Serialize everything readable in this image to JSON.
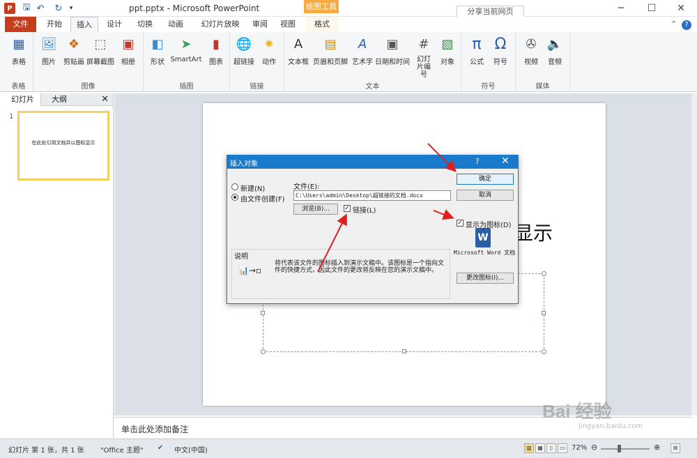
{
  "window": {
    "app_icon": "P",
    "title": "ppt.pptx - Microsoft PowerPoint",
    "context_tab_group": "绘图工具",
    "share_button": "分享当前网页"
  },
  "tabs": {
    "file": "文件",
    "items": [
      "开始",
      "插入",
      "设计",
      "切换",
      "动画",
      "幻灯片放映",
      "审阅",
      "视图",
      "格式"
    ],
    "active": "插入"
  },
  "ribbon": {
    "groups": [
      {
        "label": "表格",
        "buttons": [
          "表格"
        ]
      },
      {
        "label": "图像",
        "buttons": [
          "图片",
          "剪贴画",
          "屏幕截图",
          "相册"
        ]
      },
      {
        "label": "插图",
        "buttons": [
          "形状",
          "SmartArt",
          "图表"
        ]
      },
      {
        "label": "链接",
        "buttons": [
          "超链接",
          "动作"
        ]
      },
      {
        "label": "文本",
        "buttons": [
          "文本框",
          "页眉和页脚",
          "艺术字",
          "日期和时间",
          "幻灯片编号",
          "对象"
        ]
      },
      {
        "label": "符号",
        "buttons": [
          "公式",
          "符号"
        ]
      },
      {
        "label": "媒体",
        "buttons": [
          "视频",
          "音频"
        ]
      }
    ]
  },
  "left_panel": {
    "tabs": [
      "幻灯片",
      "大纲"
    ],
    "slide_number": "1",
    "thumbnail_text": "在此处引用文档并以图标显示"
  },
  "slide": {
    "visible_text": "显示"
  },
  "notes": {
    "placeholder": "单击此处添加备注"
  },
  "status": {
    "slide_info": "幻灯片 第 1 张，共 1 张",
    "theme": "\"Office 主题\"",
    "language": "中文(中国)",
    "zoom": "72%"
  },
  "dialog": {
    "title": "插入对象",
    "help": "?",
    "close": "✕",
    "radio_new": "新建(N)",
    "radio_from_file": "由文件创建(F)",
    "file_label": "文件(E):",
    "file_path": "C:\\Users\\admin\\Desktop\\超链接的文档.docx",
    "browse_button": "浏览(B)...",
    "link_checkbox": "链接(L)",
    "display_as_icon": "显示为图标(D)",
    "ok_button": "确定",
    "cancel_button": "取消",
    "icon_caption": "Microsoft Word 文档",
    "change_icon_button": "更改图标(I)...",
    "result_label": "说明",
    "result_text": "将代表该文件的图标插入到演示文稿中。该图标是一个指向文件的快捷方式，因此文件的更改将反映在您的演示文稿中。"
  },
  "watermark": {
    "main": "Bai 经验",
    "sub": "jingyan.baidu.com"
  },
  "colors": {
    "accent": "#c43e1c",
    "dialog_title": "#1979ca",
    "annotation": "#e02020"
  }
}
